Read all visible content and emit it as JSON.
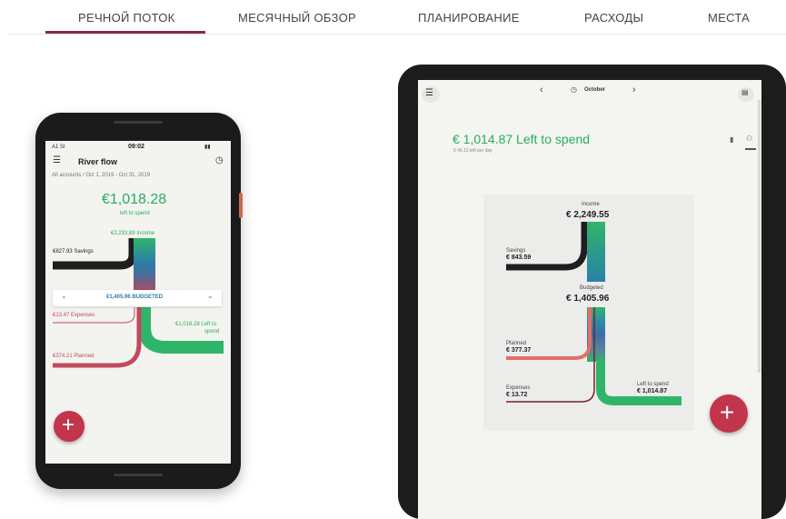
{
  "nav": {
    "tabs": [
      "РЕЧНОЙ ПОТОК",
      "МЕСЯЧНЫЙ ОБЗОР",
      "ПЛАНИРОВАНИЕ",
      "РАСХОДЫ",
      "МЕСТА"
    ],
    "active_index": 0
  },
  "phone": {
    "status": {
      "carrier": "A1 SI",
      "time": "09:02"
    },
    "title": "River flow",
    "subtitle": "All accounts / Oct 1, 2019 - Oct 31, 2019",
    "amount": "€1,018.28",
    "amount_caption": "left to spend",
    "income": "€2,233.89 Income",
    "savings": "€827.93 Savings",
    "budgeted": "€1,405.96 BUDGETED",
    "expenses": "€13.47 Expenses",
    "left_to_spend_1": "€1,018.28 Left to",
    "left_to_spend_2": "spend",
    "planned": "€374.21 Planned",
    "fab_icon": "plus-icon"
  },
  "tablet": {
    "month": "October",
    "headline": "€ 1,014.87 Left to spend",
    "per_day": "€ 46.13 left per day",
    "income_label": "Income",
    "income_value": "€ 2,249.55",
    "savings_label": "Savings",
    "savings_value": "€ 843.59",
    "budgeted_label": "Budgeted",
    "budgeted_value": "€ 1,405.96",
    "planned_label": "Planned",
    "planned_value": "€ 377.37",
    "expenses_label": "Expenses",
    "expenses_value": "€ 13.72",
    "left_label": "Left to spend",
    "left_value": "€ 1,014.87",
    "fab_icon": "plus-icon"
  },
  "colors": {
    "accent": "#8b2844",
    "green": "#27ae60",
    "fab": "#c2354b",
    "savings": "#1e1e1e",
    "planned": "#e07068",
    "expenses": "#7a1f2f"
  }
}
